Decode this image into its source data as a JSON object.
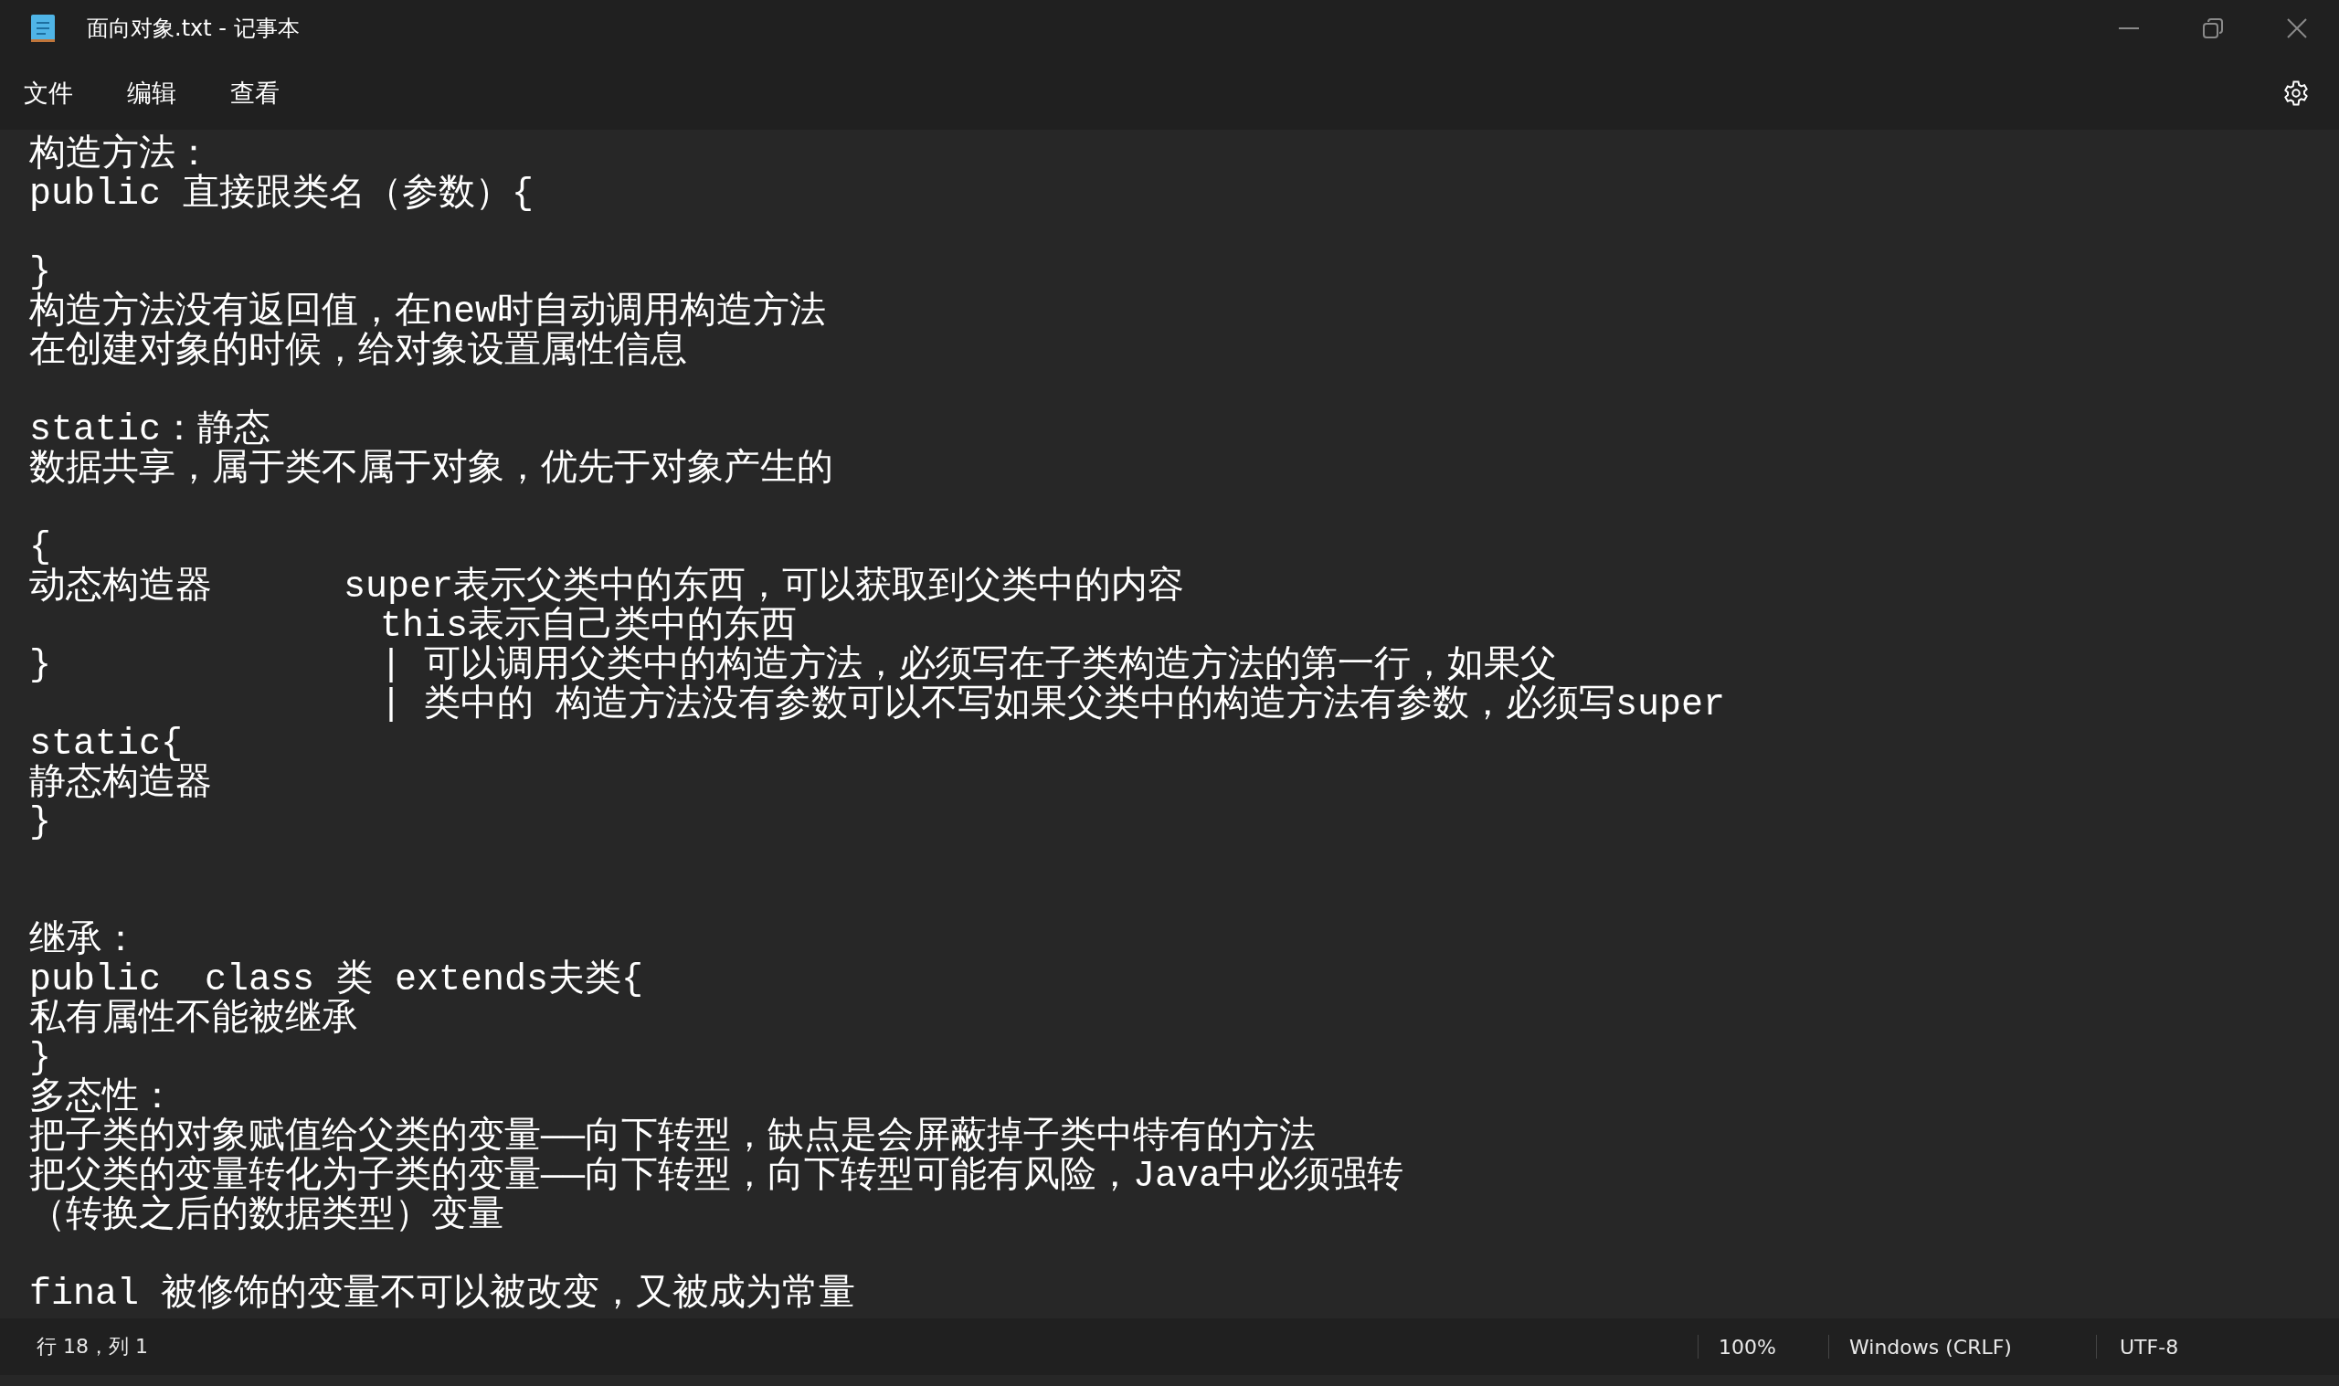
{
  "window": {
    "title": "面向对象.txt - 记事本"
  },
  "menu": [
    {
      "label": "文件"
    },
    {
      "label": "编辑"
    },
    {
      "label": "查看"
    }
  ],
  "editor": {
    "lines": [
      {
        "kind": "text",
        "text": "构造方法："
      },
      {
        "kind": "text",
        "text": "public 直接跟类名（参数）{"
      },
      {
        "kind": "blank"
      },
      {
        "kind": "text",
        "text": "}"
      },
      {
        "kind": "text",
        "text": "构造方法没有返回值，在new时自动调用构造方法"
      },
      {
        "kind": "text",
        "text": "在创建对象的时候，给对象设置属性信息"
      },
      {
        "kind": "blank"
      },
      {
        "kind": "text",
        "text": "static：静态"
      },
      {
        "kind": "text",
        "text": "数据共享，属于类不属于对象，优先于对象产生的"
      },
      {
        "kind": "blank"
      },
      {
        "kind": "text",
        "text": "{"
      },
      {
        "kind": "text",
        "text": "动态构造器      super表示父类中的东西，可以获取到父类中的内容"
      },
      {
        "kind": "text",
        "text": "                this表示自己类中的东西"
      },
      {
        "kind": "text",
        "text": "}               | 可以调用父类中的构造方法，必须写在子类构造方法的第一行，如果父"
      },
      {
        "kind": "text",
        "text": "                | 类中的 构造方法没有参数可以不写如果父类中的构造方法有参数，必须写super"
      },
      {
        "kind": "text",
        "text": "static{"
      },
      {
        "kind": "text",
        "text": "静态构造器"
      },
      {
        "kind": "text",
        "text": "}"
      },
      {
        "kind": "blank"
      },
      {
        "kind": "blank"
      },
      {
        "kind": "text",
        "text": "继承："
      },
      {
        "kind": "text",
        "text": "public  class 类 extends夫类{"
      },
      {
        "kind": "text",
        "text": "私有属性不能被继承"
      },
      {
        "kind": "text",
        "text": "}"
      },
      {
        "kind": "text",
        "text": "多态性："
      },
      {
        "kind": "text",
        "text": "把子类的对象赋值给父类的变量——向下转型，缺点是会屏蔽掉子类中特有的方法"
      },
      {
        "kind": "text",
        "text": "把父类的变量转化为子类的变量——向下转型，向下转型可能有风险，Java中必须强转"
      },
      {
        "kind": "text",
        "text": "（转换之后的数据类型）变量"
      },
      {
        "kind": "blank"
      },
      {
        "kind": "text",
        "text": "final 被修饰的变量不可以被改变，又被成为常量"
      }
    ]
  },
  "status_bar": {
    "position": "行 18，列 1",
    "zoom": "100%",
    "line_ending": "Windows (CRLF)",
    "encoding": "UTF-8"
  }
}
